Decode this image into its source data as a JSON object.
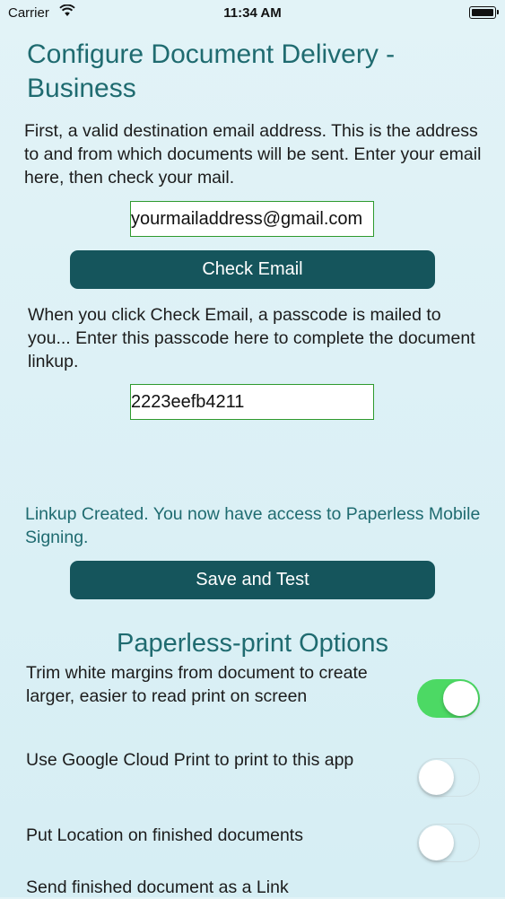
{
  "status_bar": {
    "carrier": "Carrier",
    "time": "11:34 AM"
  },
  "page": {
    "title": "Configure Document Delivery - Business"
  },
  "email_section": {
    "instructions": "First, a valid destination email address. This is the address to and from which documents will be sent. Enter your email here, then check your mail.",
    "email_value": "yourmailaddress@gmail.com",
    "check_button": "Check Email"
  },
  "passcode_section": {
    "instructions": "When you click Check Email, a passcode is mailed to you... Enter this passcode here to complete the document linkup.",
    "passcode_value": "2223eefb4211"
  },
  "linkup_status": "Linkup Created. You now have access to Paperless Mobile Signing.",
  "save_button": "Save and Test",
  "options": {
    "title": "Paperless-print Options",
    "items": [
      {
        "label": "Trim white margins from document to create larger, easier to read print on screen",
        "enabled": true
      },
      {
        "label": "Use Google Cloud Print to print to this app",
        "enabled": false
      },
      {
        "label": "Put Location on finished documents",
        "enabled": false
      },
      {
        "label": "Send finished document as a Link",
        "enabled": false
      }
    ]
  },
  "colors": {
    "accent": "#1f6b70",
    "button": "#15555c",
    "toggle_on": "#4cd964",
    "field_border": "#2e9a2e"
  }
}
